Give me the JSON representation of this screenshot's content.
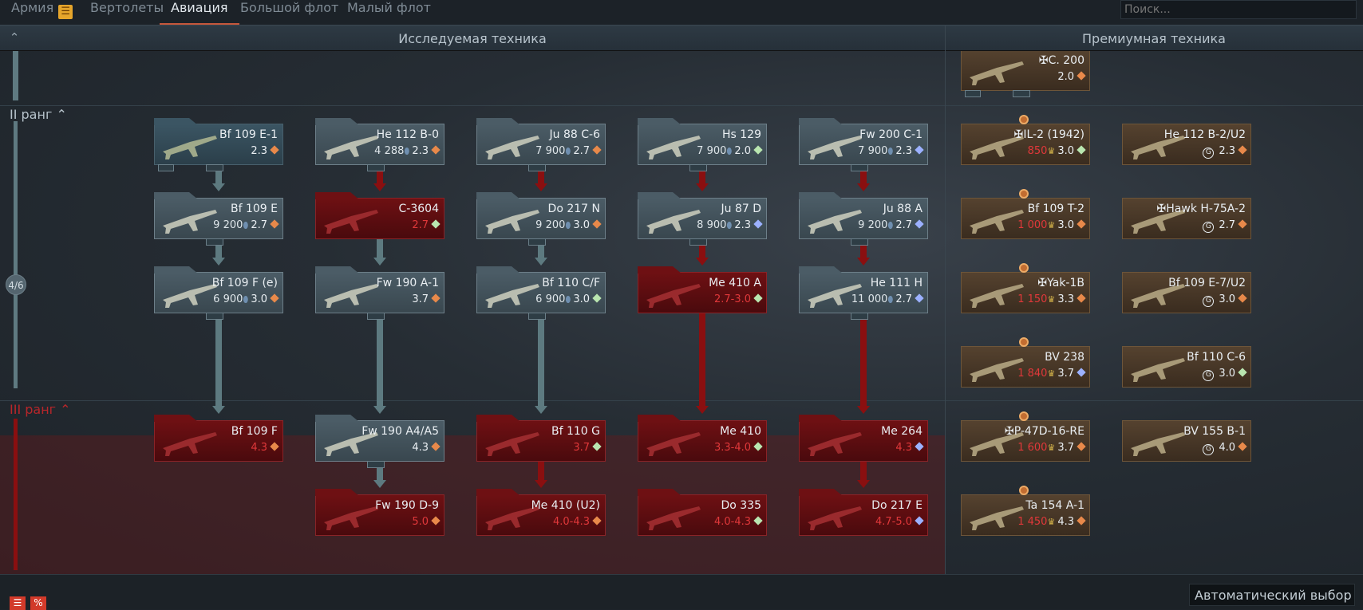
{
  "tabs": [
    {
      "label": "Армия"
    },
    {
      "label": "Вертолеты"
    },
    {
      "label": "Авиация"
    },
    {
      "label": "Большой флот"
    },
    {
      "label": "Малый флот"
    }
  ],
  "search": {
    "placeholder": "Поиск..."
  },
  "header": {
    "research_title": "Исследуемая техника",
    "premium_title": "Премиумная техника"
  },
  "ranks": {
    "rank2": "II ранг",
    "rank3": "III ранг",
    "progress": "4/6"
  },
  "cards": [
    {
      "name": "✠C. 200",
      "br": "2.0",
      "cost": "",
      "golden": false,
      "state": "premium",
      "type": "arcade"
    },
    {
      "name": "Bf 109 E-1",
      "br": "2.3",
      "cost": "",
      "golden": false,
      "state": "researched",
      "type": "arcade"
    },
    {
      "name": "He 112 B-0",
      "br": "2.3",
      "cost": "4 288",
      "golden": false,
      "state": "unlocked",
      "type": "arcade"
    },
    {
      "name": "Ju 88 C-6",
      "br": "2.7",
      "cost": "7 900",
      "golden": false,
      "state": "unlocked",
      "type": "arcade"
    },
    {
      "name": "Hs 129",
      "br": "2.0",
      "cost": "7 900",
      "golden": false,
      "state": "unlocked",
      "type": "green"
    },
    {
      "name": "Fw 200 C-1",
      "br": "2.3",
      "cost": "7 900",
      "golden": false,
      "state": "unlocked",
      "type": "blue"
    },
    {
      "name": "✠IL-2 (1942)",
      "br": "3.0",
      "cost": "850",
      "golden": true,
      "state": "premium",
      "type": "green"
    },
    {
      "name": "He 112 B-2/U2",
      "br": "2.3",
      "cost": "",
      "golden": false,
      "gift": true,
      "state": "premium",
      "type": "arcade"
    },
    {
      "name": "Bf 109 E",
      "br": "2.7",
      "cost": "9 200",
      "golden": false,
      "state": "unlocked",
      "type": "arcade"
    },
    {
      "name": "C-3604",
      "br": "2.7",
      "cost": "",
      "golden": false,
      "state": "locked",
      "type": "green"
    },
    {
      "name": "Do 217 N",
      "br": "3.0",
      "cost": "9 200",
      "golden": false,
      "state": "unlocked",
      "type": "arcade"
    },
    {
      "name": "Ju 87 D",
      "br": "2.3",
      "cost": "8 900",
      "golden": false,
      "state": "unlocked",
      "type": "blue"
    },
    {
      "name": "Ju 88 A",
      "br": "2.7",
      "cost": "9 200",
      "golden": false,
      "state": "unlocked",
      "type": "blue"
    },
    {
      "name": "Bf 109 T-2",
      "br": "3.0",
      "cost": "1 000",
      "golden": true,
      "state": "premium",
      "type": "arcade"
    },
    {
      "name": "✠Hawk H-75A-2",
      "br": "2.7",
      "cost": "",
      "golden": false,
      "gift": true,
      "state": "premium",
      "type": "arcade"
    },
    {
      "name": "Bf 109 F (e)",
      "br": "3.0",
      "cost": "6 900",
      "golden": false,
      "state": "unlocked",
      "type": "arcade"
    },
    {
      "name": "Fw 190 A-1",
      "br": "3.7",
      "cost": "",
      "golden": false,
      "state": "unlocked",
      "type": "arcade"
    },
    {
      "name": "Bf 110 C/F",
      "br": "3.0",
      "cost": "6 900",
      "golden": false,
      "state": "unlocked",
      "type": "green"
    },
    {
      "name": "Me 410 A",
      "br": "2.7-3.0",
      "cost": "",
      "golden": false,
      "state": "locked",
      "type": "green"
    },
    {
      "name": "He 111 H",
      "br": "2.7",
      "cost": "11 000",
      "golden": false,
      "state": "unlocked",
      "type": "blue"
    },
    {
      "name": "✠Yak-1B",
      "br": "3.3",
      "cost": "1 150",
      "golden": true,
      "state": "premium",
      "type": "arcade"
    },
    {
      "name": "Bf 109 E-7/U2",
      "br": "3.0",
      "cost": "",
      "golden": false,
      "gift": true,
      "state": "premium",
      "type": "arcade"
    },
    {
      "name": "BV 238",
      "br": "3.7",
      "cost": "1 840",
      "golden": true,
      "state": "premium",
      "type": "blue"
    },
    {
      "name": "Bf 110 C-6",
      "br": "3.0",
      "cost": "",
      "golden": false,
      "gift": true,
      "state": "premium",
      "type": "green"
    },
    {
      "name": "Bf 109 F",
      "br": "4.3",
      "cost": "",
      "golden": false,
      "state": "locked",
      "type": "arcade"
    },
    {
      "name": "Fw 190 A4/A5",
      "br": "4.3",
      "cost": "",
      "golden": false,
      "state": "unlocked",
      "type": "arcade"
    },
    {
      "name": "Bf 110 G",
      "br": "3.7",
      "cost": "",
      "golden": false,
      "state": "locked",
      "type": "green"
    },
    {
      "name": "Me 410",
      "br": "3.3-4.0",
      "cost": "",
      "golden": false,
      "state": "locked",
      "type": "green"
    },
    {
      "name": "Me 264",
      "br": "4.3",
      "cost": "",
      "golden": false,
      "state": "locked",
      "type": "blue"
    },
    {
      "name": "✠P-47D-16-RE",
      "br": "3.7",
      "cost": "1 600",
      "golden": true,
      "state": "premium",
      "type": "arcade"
    },
    {
      "name": "BV 155 B-1",
      "br": "4.0",
      "cost": "",
      "golden": false,
      "gift": true,
      "state": "premium",
      "type": "arcade"
    },
    {
      "name": "Fw 190 D-9",
      "br": "5.0",
      "cost": "",
      "golden": false,
      "state": "locked",
      "type": "arcade"
    },
    {
      "name": "Me 410 (U2)",
      "br": "4.0-4.3",
      "cost": "",
      "golden": false,
      "state": "locked",
      "type": "arcade"
    },
    {
      "name": "Do 335",
      "br": "4.0-4.3",
      "cost": "",
      "golden": false,
      "state": "locked",
      "type": "green"
    },
    {
      "name": "Do 217 E",
      "br": "4.7-5.0",
      "cost": "",
      "golden": false,
      "state": "locked",
      "type": "blue"
    },
    {
      "name": "Ta 154 A-1",
      "br": "4.3",
      "cost": "1 450",
      "golden": true,
      "state": "premium",
      "type": "arcade"
    }
  ],
  "bottom": {
    "auto_select": "Автоматический выбор"
  },
  "colors": {
    "arcade": "#e8894a",
    "green": "#b9e6b0",
    "blue": "#9cb1ff",
    "locked_text": "#e0383a",
    "accent": "#c6573b"
  }
}
